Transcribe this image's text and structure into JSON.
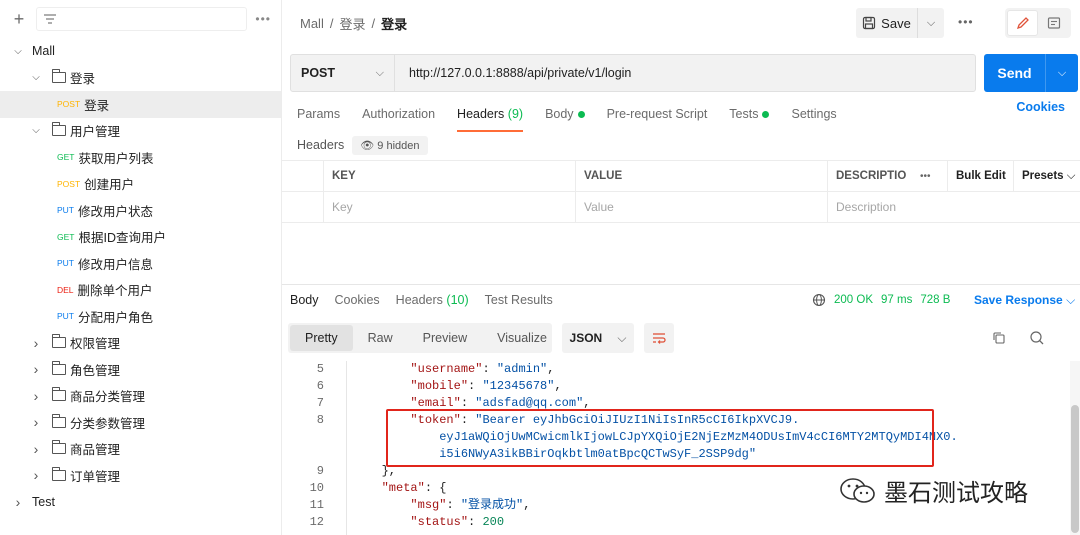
{
  "sidebar": {
    "plus_icon": "plus-icon",
    "filter_icon": "filter-icon",
    "more_icon": "more-icon",
    "items": [
      {
        "label": "Mall",
        "type": "collection",
        "expanded": true,
        "level": 0
      },
      {
        "label": "登录",
        "type": "folder",
        "expanded": true,
        "level": 1
      },
      {
        "label": "登录",
        "type": "request",
        "method": "POST",
        "level": 2,
        "active": true
      },
      {
        "label": "用户管理",
        "type": "folder",
        "expanded": true,
        "level": 1
      },
      {
        "label": "获取用户列表",
        "type": "request",
        "method": "GET",
        "level": 2
      },
      {
        "label": "创建用户",
        "type": "request",
        "method": "POST",
        "level": 2
      },
      {
        "label": "修改用户状态",
        "type": "request",
        "method": "PUT",
        "level": 2
      },
      {
        "label": "根据ID查询用户",
        "type": "request",
        "method": "GET",
        "level": 2
      },
      {
        "label": "修改用户信息",
        "type": "request",
        "method": "PUT",
        "level": 2
      },
      {
        "label": "删除单个用户",
        "type": "request",
        "method": "DEL",
        "level": 2
      },
      {
        "label": "分配用户角色",
        "type": "request",
        "method": "PUT",
        "level": 2
      },
      {
        "label": "权限管理",
        "type": "folder",
        "expanded": false,
        "level": 1
      },
      {
        "label": "角色管理",
        "type": "folder",
        "expanded": false,
        "level": 1
      },
      {
        "label": "商品分类管理",
        "type": "folder",
        "expanded": false,
        "level": 1
      },
      {
        "label": "分类参数管理",
        "type": "folder",
        "expanded": false,
        "level": 1
      },
      {
        "label": "商品管理",
        "type": "folder",
        "expanded": false,
        "level": 1
      },
      {
        "label": "订单管理",
        "type": "folder",
        "expanded": false,
        "level": 1
      },
      {
        "label": "Test",
        "type": "collection",
        "expanded": false,
        "level": 0
      }
    ]
  },
  "breadcrumb": {
    "part1": "Mall",
    "sep": "/",
    "part2": "登录",
    "current": "登录"
  },
  "toolbar": {
    "save_label": "Save"
  },
  "request": {
    "method": "POST",
    "url": "http://127.0.0.1:8888/api/private/v1/login",
    "send_label": "Send"
  },
  "tabs": {
    "params": "Params",
    "authorization": "Authorization",
    "headers": "Headers",
    "headers_count": "(9)",
    "body": "Body",
    "prerequest": "Pre-request Script",
    "tests": "Tests",
    "settings": "Settings",
    "cookies": "Cookies"
  },
  "headers_section": {
    "label": "Headers",
    "hidden": "9 hidden",
    "col_key": "KEY",
    "col_value": "VALUE",
    "col_desc": "DESCRIPTIO",
    "bulk_edit": "Bulk Edit",
    "presets": "Presets",
    "ph_key": "Key",
    "ph_value": "Value",
    "ph_desc": "Description"
  },
  "response": {
    "tabs": {
      "body": "Body",
      "cookies": "Cookies",
      "headers": "Headers",
      "headers_count": "(10)",
      "test_results": "Test Results"
    },
    "status": "200 OK",
    "time": "97 ms",
    "size": "728 B",
    "save_response": "Save Response",
    "formats": {
      "pretty": "Pretty",
      "raw": "Raw",
      "preview": "Preview",
      "visualize": "Visualize"
    },
    "language": "JSON",
    "code_lines": [
      {
        "num": "5",
        "indent": "        ",
        "key": "\"username\"",
        "sep": ": ",
        "val": "\"admin\"",
        "tail": ",",
        "vtype": "s"
      },
      {
        "num": "6",
        "indent": "        ",
        "key": "\"mobile\"",
        "sep": ": ",
        "val": "\"12345678\"",
        "tail": ",",
        "vtype": "s"
      },
      {
        "num": "7",
        "indent": "        ",
        "key": "\"email\"",
        "sep": ": ",
        "val": "\"adsfad@qq.com\"",
        "tail": ",",
        "vtype": "s"
      },
      {
        "num": "8",
        "indent": "        ",
        "key": "\"token\"",
        "sep": ": ",
        "val": "\"Bearer eyJhbGciOiJIUzI1NiIsInR5cCI6IkpXVCJ9.",
        "tail": "",
        "vtype": "s"
      },
      {
        "num": "",
        "indent": "            ",
        "key": "",
        "sep": "",
        "val": "eyJ1aWQiOjUwMCwicmlkIjowLCJpYXQiOjE2NjEzMzM4ODUsImV4cCI6MTY2MTQyMDI4NX0.",
        "tail": "",
        "vtype": "s"
      },
      {
        "num": "",
        "indent": "            ",
        "key": "",
        "sep": "",
        "val": "i5i6NWyA3ikBBirOqkbtlm0atBpcQCTwSyF_2SSP9dg\"",
        "tail": "",
        "vtype": "s"
      },
      {
        "num": "9",
        "indent": "    ",
        "key": "",
        "sep": "",
        "val": "},",
        "tail": "",
        "vtype": "p"
      },
      {
        "num": "10",
        "indent": "    ",
        "key": "\"meta\"",
        "sep": ": ",
        "val": "{",
        "tail": "",
        "vtype": "p"
      },
      {
        "num": "11",
        "indent": "        ",
        "key": "\"msg\"",
        "sep": ": ",
        "val": "\"登录成功\"",
        "tail": ",",
        "vtype": "s"
      },
      {
        "num": "12",
        "indent": "        ",
        "key": "\"status\"",
        "sep": ": ",
        "val": "200",
        "tail": "",
        "vtype": "n"
      }
    ]
  },
  "watermark": {
    "text": "墨石测试攻略"
  }
}
